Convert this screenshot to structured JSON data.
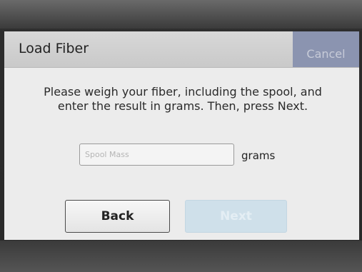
{
  "header": {
    "title": "Load Fiber",
    "cancel_label": "Cancel"
  },
  "main": {
    "instructions": "Please weigh your fiber, including the spool, and enter the result in grams. Then, press Next.",
    "mass_input": {
      "placeholder": "Spool Mass",
      "value": ""
    },
    "unit_label": "grams"
  },
  "footer": {
    "back_label": "Back",
    "next_label": "Next"
  },
  "colors": {
    "cancel_bg": "#8b94b0",
    "next_disabled_bg": "#cfe0ea"
  }
}
